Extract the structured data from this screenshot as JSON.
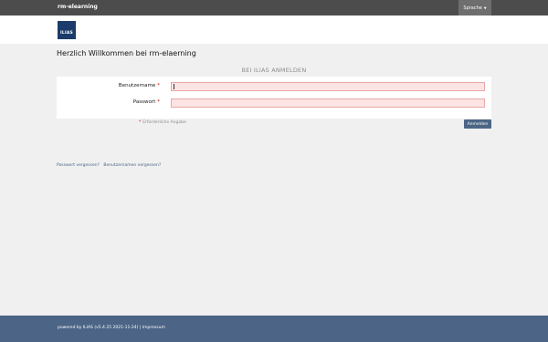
{
  "topbar": {
    "app_title": "rm-elearning",
    "language_button": "Sprache"
  },
  "header": {
    "logo_text": "ILIAS"
  },
  "main": {
    "welcome": "Herzlich Willkommen bei rm-elaerning",
    "login_heading": "BEI ILIAS ANMELDEN",
    "username_label": "Benutzername",
    "password_label": "Passwort",
    "required_marker": "*",
    "required_note": "Erforderliche Angabe",
    "submit_label": "Anmelden",
    "username_value": "",
    "password_value": ""
  },
  "links": {
    "forgot_password": "Passwort vergessen?",
    "forgot_username": "Benutzernamen vergessen?"
  },
  "footer": {
    "powered_by": "powered by ILIAS (v5.4.25 2021-11-24)",
    "separator": "|",
    "imprint": "Impressum"
  },
  "colors": {
    "topbar": "#4c4c4c",
    "accent": "#4c6586",
    "required": "#c80000",
    "field_error_bg": "#fce4e4"
  },
  "icons": {
    "language_button": "caret-down-icon"
  }
}
